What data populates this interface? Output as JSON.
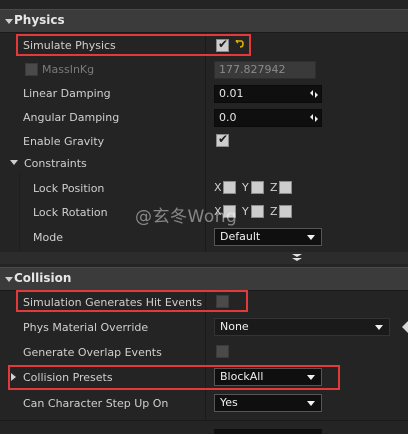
{
  "physics": {
    "title": "Physics",
    "rows": {
      "simulate_physics": "Simulate Physics",
      "mass_in_kg": "MassInKg",
      "mass_value": "177.827942",
      "linear_damping": "Linear Damping",
      "linear_damping_value": "0.01",
      "angular_damping": "Angular Damping",
      "angular_damping_value": "0.0",
      "enable_gravity": "Enable Gravity",
      "constraints": "Constraints",
      "lock_position": "Lock Position",
      "lock_rotation": "Lock Rotation",
      "mode": "Mode",
      "mode_value": "Default"
    },
    "axes": {
      "x": "X",
      "y": "Y",
      "z": "Z"
    }
  },
  "collision": {
    "title": "Collision",
    "rows": {
      "sim_hit_events": "Simulation Generates Hit Events",
      "phys_material_override": "Phys Material Override",
      "phys_material_value": "None",
      "generate_overlap_events": "Generate Overlap Events",
      "collision_presets": "Collision Presets",
      "collision_presets_value": "BlockAll",
      "can_step_up": "Can Character Step Up On",
      "can_step_up_value": "Yes"
    }
  },
  "watermark": "@玄冬Wong",
  "colors": {
    "highlight": "#e23a3a",
    "reset_arrow": "#e0b000"
  }
}
